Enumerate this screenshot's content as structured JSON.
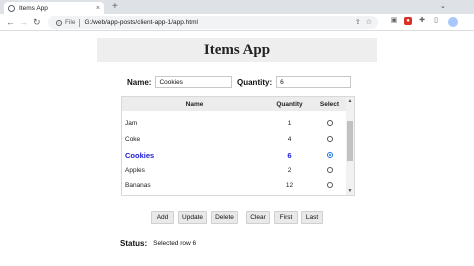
{
  "browser": {
    "tab_title": "Items App",
    "tab_close": "×",
    "new_tab": "+",
    "win_minimize": "⌄",
    "nav_back": "←",
    "nav_forward": "→",
    "nav_reload": "↻",
    "omnibox_file": "File",
    "omnibox_url": "G:/web/app-posts/client-app-1/app.html",
    "omnibox_icons": [
      "⇪",
      "☆"
    ],
    "info_glyph": "i"
  },
  "app": {
    "title": "Items App"
  },
  "form": {
    "name_label": "Name:",
    "name_value": "Cookies",
    "quantity_label": "Quantity:",
    "quantity_value": "6"
  },
  "list": {
    "headers": {
      "name": "Name",
      "quantity": "Quantity",
      "select": "Select"
    },
    "rows": [
      {
        "name": "Jam",
        "quantity": "1",
        "selected": false
      },
      {
        "name": "Coke",
        "quantity": "4",
        "selected": false
      },
      {
        "name": "Cookies",
        "quantity": "6",
        "selected": true
      },
      {
        "name": "Apples",
        "quantity": "2",
        "selected": false
      },
      {
        "name": "Bananas",
        "quantity": "12",
        "selected": false
      }
    ],
    "scroll_up": "▲",
    "scroll_down": "▼"
  },
  "buttons": {
    "add": "Add",
    "update": "Update",
    "delete": "Delete",
    "clear": "Clear",
    "first": "First",
    "last": "Last"
  },
  "status": {
    "label": "Status:",
    "text": "Selected row 6"
  },
  "colors": {
    "selected_row": "#1a1ad6",
    "header_bg": "#eeeeee"
  }
}
